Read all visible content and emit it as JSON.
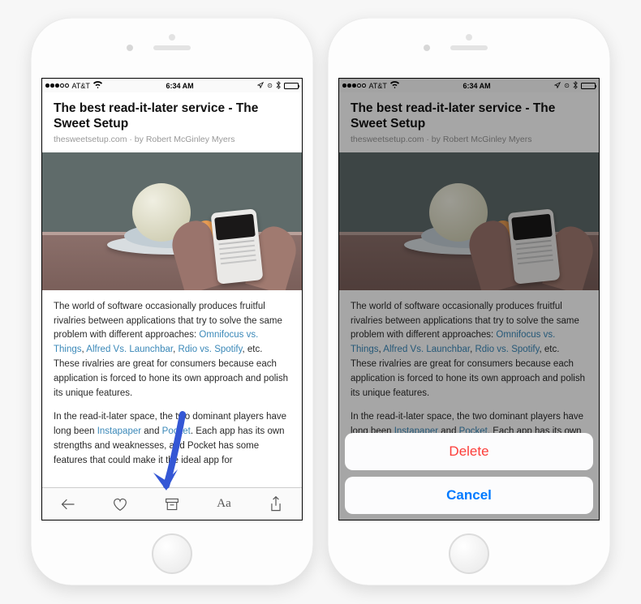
{
  "status": {
    "carrier": "AT&T",
    "wifi_icon": "wifi-icon",
    "time": "6:34 AM",
    "bluetooth_icon": "bluetooth-icon",
    "location_icon": "location-icon"
  },
  "article": {
    "title": "The best read-it-later service - The Sweet Setup",
    "source": "thesweetsetup.com",
    "byline_sep": " · by ",
    "author": "Robert McGinley Myers",
    "p1_a": "The world of software occasionally produces fruitful rivalries between applications that try to solve the same problem with different approaches: ",
    "link1": "Omnifocus vs. Things",
    "sep": ", ",
    "link2": "Alfred Vs. Launchbar",
    "link3": "Rdio vs. Spotify",
    "p1_b": ", etc. These rivalries are great for consumers because each application is forced to hone its own approach and polish its unique features.",
    "p2_a": "In the read-it-later space, the two dominant players have long been ",
    "link4": "Instapaper",
    "and": " and ",
    "link5": "Pocket",
    "p2_b": ". Each app has its own strengths and weaknesses, and Pocket has some features that could make it the ideal app for"
  },
  "toolbar": {
    "back": "back-icon",
    "like": "heart-icon",
    "archive": "archive-icon",
    "appearance": "text-appearance-icon",
    "appearance_label": "Aa",
    "share": "share-icon"
  },
  "sheet": {
    "delete": "Delete",
    "cancel": "Cancel"
  }
}
